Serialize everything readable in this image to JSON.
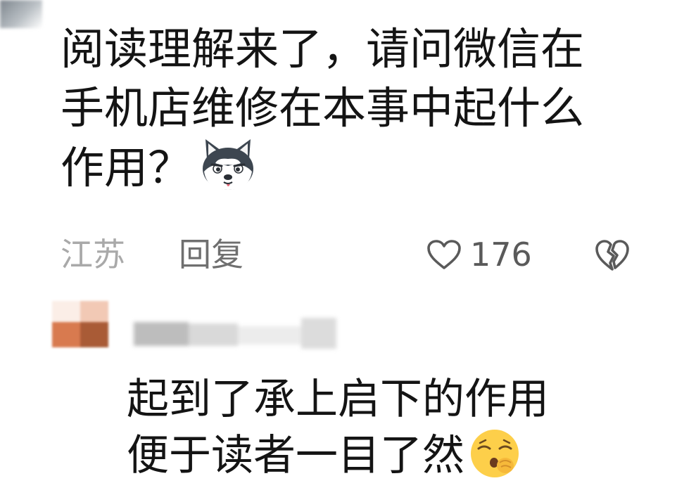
{
  "comment": {
    "lines": [
      "阅读理解来了，请问微信在",
      "手机店维修在本事中起什么",
      "作用？"
    ],
    "emoji": "husky-dog-emoji"
  },
  "meta": {
    "location": "江苏",
    "reply_label": "回复",
    "like_count": "176"
  },
  "icons": {
    "like": "heart-outline-icon",
    "dislike": "broken-heart-icon"
  },
  "reply_comment": {
    "lines": [
      "起到了承上启下的作用",
      "便于读者一目了然"
    ],
    "emoji": "yawning-face-emoji"
  },
  "colors": {
    "text": "#141414",
    "location": "#a9a9a9",
    "reply_action": "#6f6f6f",
    "like": "#5a5a5a"
  }
}
